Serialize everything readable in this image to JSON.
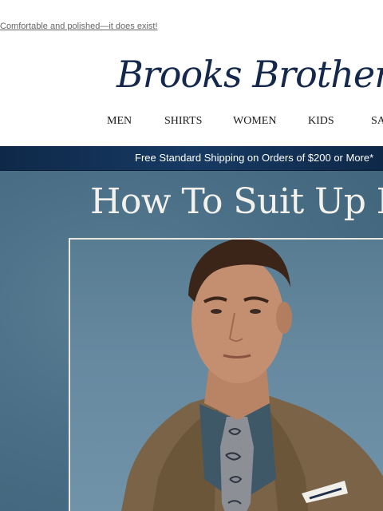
{
  "preheader": {
    "text": "Comfortable and polished—it does exist!"
  },
  "brand": {
    "logo_text": "Brooks Brothers",
    "color": "#14284b"
  },
  "nav": {
    "items": [
      {
        "label": "MEN"
      },
      {
        "label": "SHIRTS"
      },
      {
        "label": "WOMEN"
      },
      {
        "label": "KIDS"
      },
      {
        "label": "SA"
      }
    ]
  },
  "promo_bar": {
    "text": "Free Standard Shipping on Orders of $200 or More*",
    "background": "#0f2a4a"
  },
  "hero": {
    "title": "How To Suit Up No",
    "background": "#4b6f85"
  }
}
